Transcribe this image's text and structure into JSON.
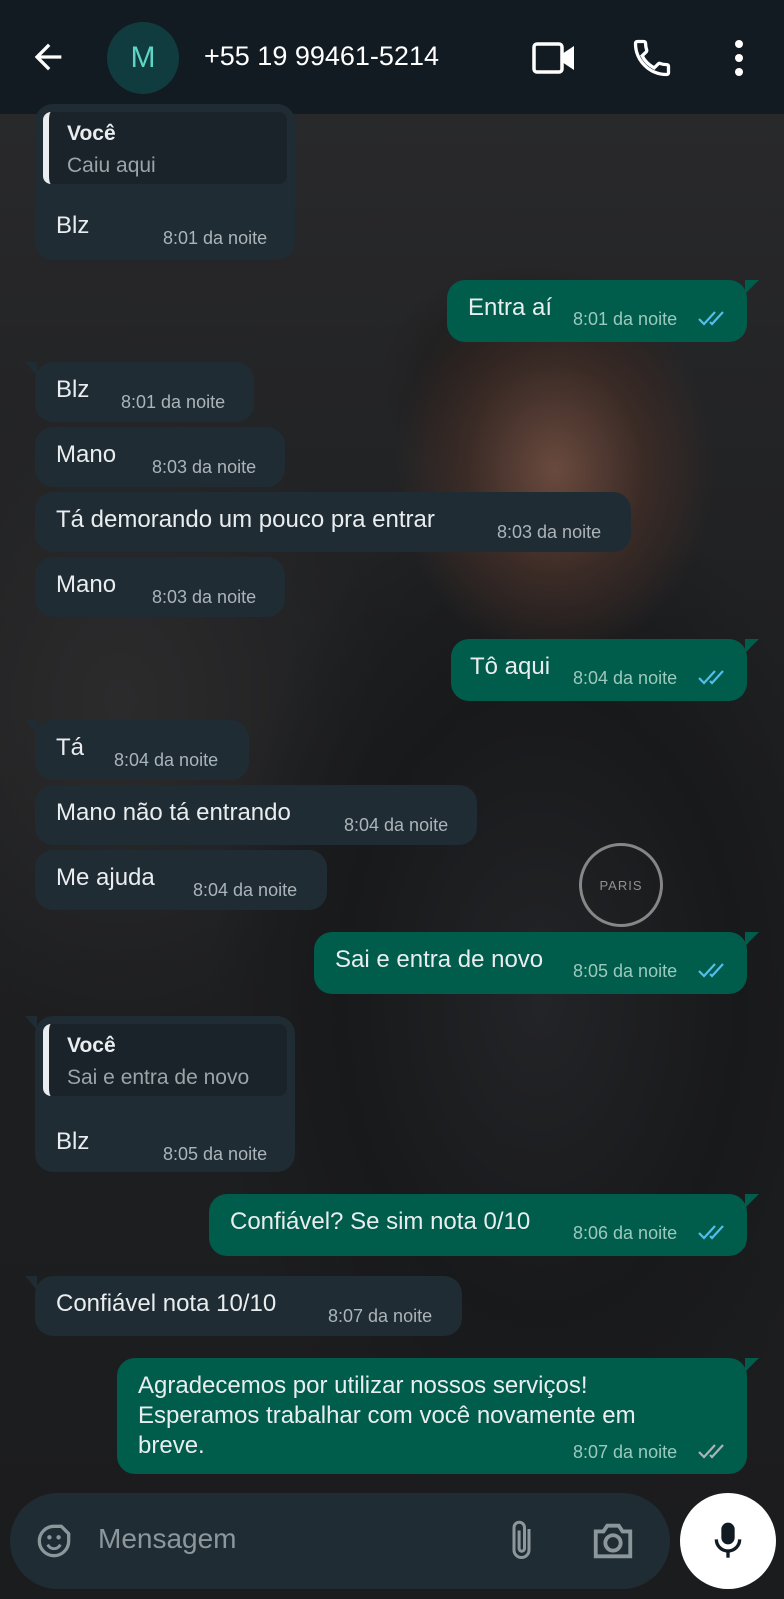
{
  "header": {
    "avatar_letter": "M",
    "contact": "+55 19 99461-5214",
    "icons": [
      "back-arrow-icon",
      "video-call-icon",
      "phone-icon",
      "more-options-icon"
    ]
  },
  "wallpaper": {
    "crest_text": "PARIS"
  },
  "messages": [
    {
      "dir": "in",
      "quote_author": "Você",
      "quote_text": "Caiu aqui",
      "text": "Blz",
      "time": "8:01 da noite"
    },
    {
      "dir": "out",
      "text": "Entra aí",
      "time": "8:01 da noite",
      "status": "read"
    },
    {
      "dir": "in",
      "text": "Blz",
      "time": "8:01 da noite"
    },
    {
      "dir": "in",
      "text": "Mano",
      "time": "8:03 da noite"
    },
    {
      "dir": "in",
      "text": "Tá demorando um pouco pra entrar",
      "time": "8:03 da noite"
    },
    {
      "dir": "in",
      "text": "Mano",
      "time": "8:03 da noite"
    },
    {
      "dir": "out",
      "text": "Tô aqui",
      "time": "8:04 da noite",
      "status": "read"
    },
    {
      "dir": "in",
      "text": "Tá",
      "time": "8:04 da noite"
    },
    {
      "dir": "in",
      "text": "Mano não tá entrando",
      "time": "8:04 da noite"
    },
    {
      "dir": "in",
      "text": "Me ajuda",
      "time": "8:04 da noite"
    },
    {
      "dir": "out",
      "text": "Sai e entra de novo",
      "time": "8:05 da noite",
      "status": "read"
    },
    {
      "dir": "in",
      "quote_author": "Você",
      "quote_text": "Sai e entra de novo",
      "text": "Blz",
      "time": "8:05 da noite"
    },
    {
      "dir": "out",
      "text": "Confiável? Se sim nota 0/10",
      "time": "8:06 da noite",
      "status": "read"
    },
    {
      "dir": "in",
      "text": "Confiável nota 10/10",
      "time": "8:07 da noite"
    },
    {
      "dir": "out",
      "lines": [
        "Agradecemos por utilizar nossos serviços!",
        "Esperamos trabalhar com você novamente em",
        "breve."
      ],
      "time": "8:07 da noite",
      "status": "delivered"
    }
  ],
  "composer": {
    "placeholder": "Mensagem",
    "icons": [
      "sticker-icon",
      "attach-icon",
      "camera-icon",
      "mic-icon"
    ]
  },
  "colors": {
    "header_bg": "#121b22",
    "incoming_bubble": "#202c33",
    "outgoing_bubble": "#005c4b",
    "read_ticks": "#53bdeb",
    "delivered_ticks": "#aab4b9"
  }
}
